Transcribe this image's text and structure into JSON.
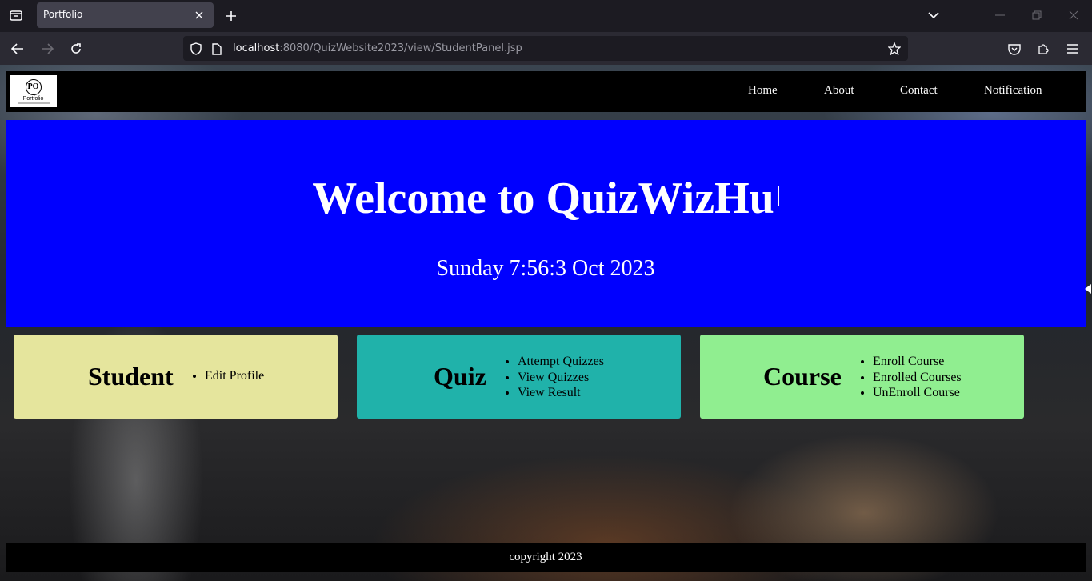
{
  "browser": {
    "tab_title": "Portfolio",
    "url_host": "localhost",
    "url_rest": ":8080/QuizWebsite2023/view/StudentPanel.jsp"
  },
  "site": {
    "logo_text": "Portfolio",
    "logo_mark": "PO",
    "nav": [
      "Home",
      "About",
      "Contact",
      "Notification"
    ]
  },
  "hero": {
    "title": "Welcome to QuizWizHu",
    "date": "Sunday 7:56:3 Oct 2023",
    "background_color": "#0000ff"
  },
  "cards": [
    {
      "title": "Student",
      "items": [
        "Edit Profile"
      ],
      "color": "#e5e59d"
    },
    {
      "title": "Quiz",
      "items": [
        "Attempt Quizzes",
        "View Quizzes",
        "View Result"
      ],
      "color": "#20b2aa"
    },
    {
      "title": "Course",
      "items": [
        "Enroll Course",
        "Enrolled Courses",
        "UnEnroll Course"
      ],
      "color": "#90ee90"
    }
  ],
  "footer": {
    "text": "copyright 2023"
  }
}
